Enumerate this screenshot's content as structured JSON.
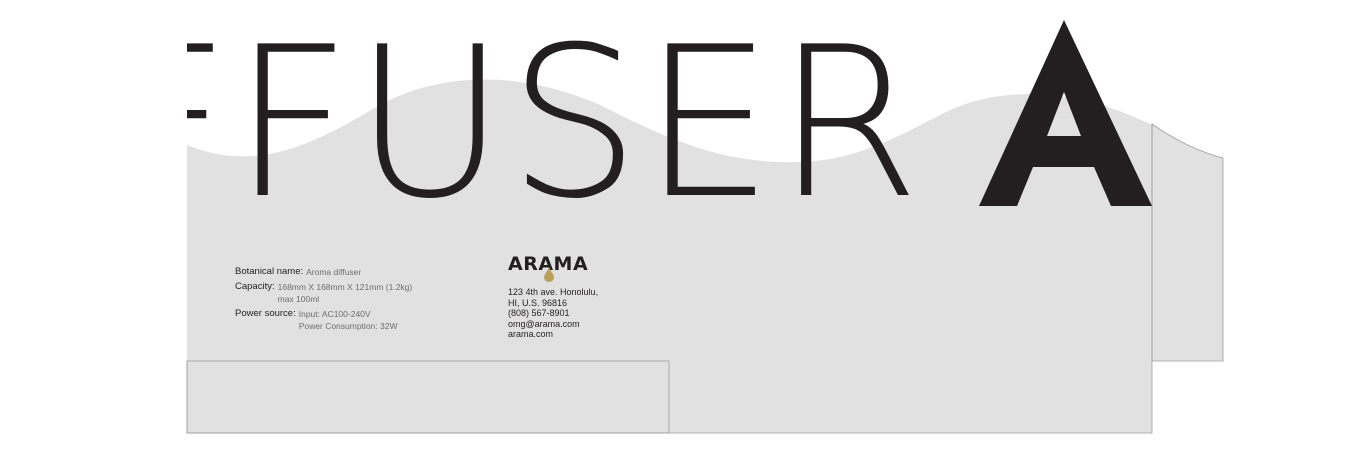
{
  "headline": {
    "text": "FFUSER",
    "big_letter": "A"
  },
  "specs": [
    {
      "label": "Botanical name:",
      "values": [
        "Aroma diffuser"
      ]
    },
    {
      "label": "Capacity:",
      "values": [
        "168mm X 168mm X 121mm (1.2kg)",
        "max 100ml"
      ]
    },
    {
      "label": "Power source:",
      "values": [
        "Input: AC100-240V",
        "Power Consumption: 32W"
      ]
    }
  ],
  "brand": {
    "logo": "ARAMA",
    "drop_color": "#b9a15a"
  },
  "contact": {
    "address_line1": "123 4th ave. Honolulu,",
    "address_line2": "HI, U.S. 96816",
    "phone": "(808) 567-8901",
    "email": "omg@arama.com",
    "website": "arama.com"
  },
  "colors": {
    "panel": "#e1e1e1",
    "ink": "#231f20",
    "secondary_text": "#6d6e70",
    "dieline": "#9d9d9d"
  }
}
